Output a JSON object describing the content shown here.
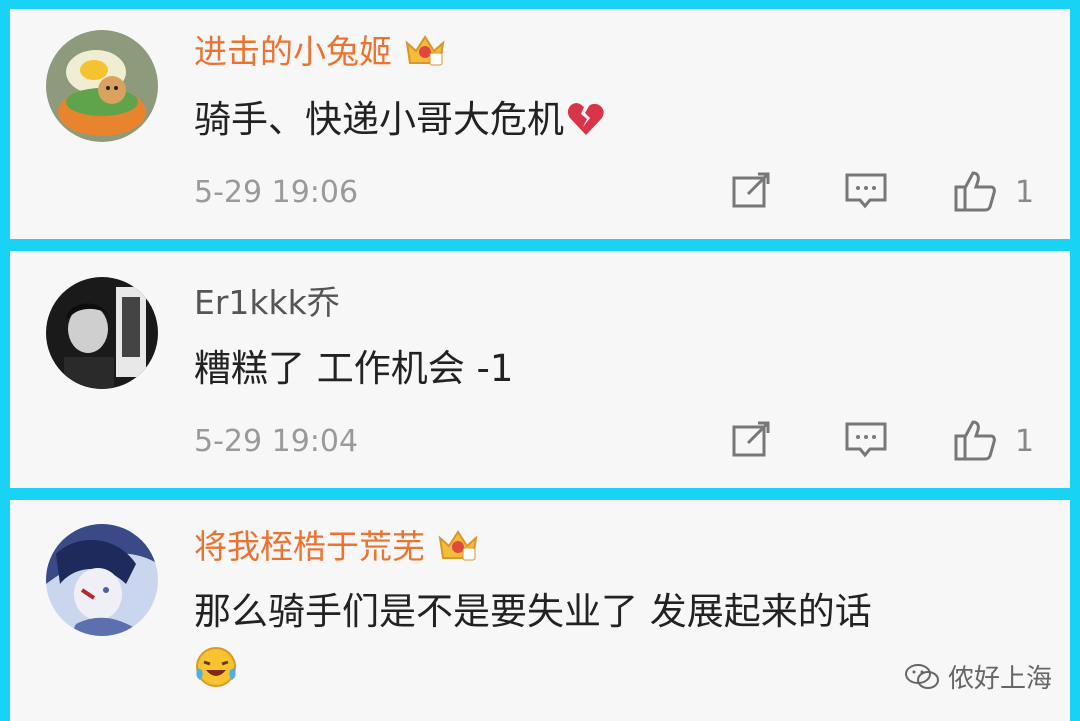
{
  "comments": [
    {
      "username": "进击的小兔姬",
      "vip_badge": "crown-badge-5",
      "text": "骑手、快递小哥大危机",
      "emoji": "broken-heart-emoji",
      "time": "5-29 19:06",
      "likes": "1"
    },
    {
      "username": "Er1kkk乔",
      "text": "糟糕了 工作机会 -1",
      "time": "5-29 19:04",
      "likes": "1"
    },
    {
      "username": "将我桎梏于荒芜",
      "vip_badge": "crown-badge-4",
      "text": "那么骑手们是不是要失业了 发展起来的话",
      "emoji": "laughing-crying-emoji"
    }
  ],
  "watermark": {
    "label": "侬好上海",
    "icon": "wechat-icon"
  },
  "colors": {
    "frame": "#19d3f5",
    "card": "#f7f7f7",
    "vip_name": "#eb7331",
    "crown": "#f3bd3a"
  }
}
